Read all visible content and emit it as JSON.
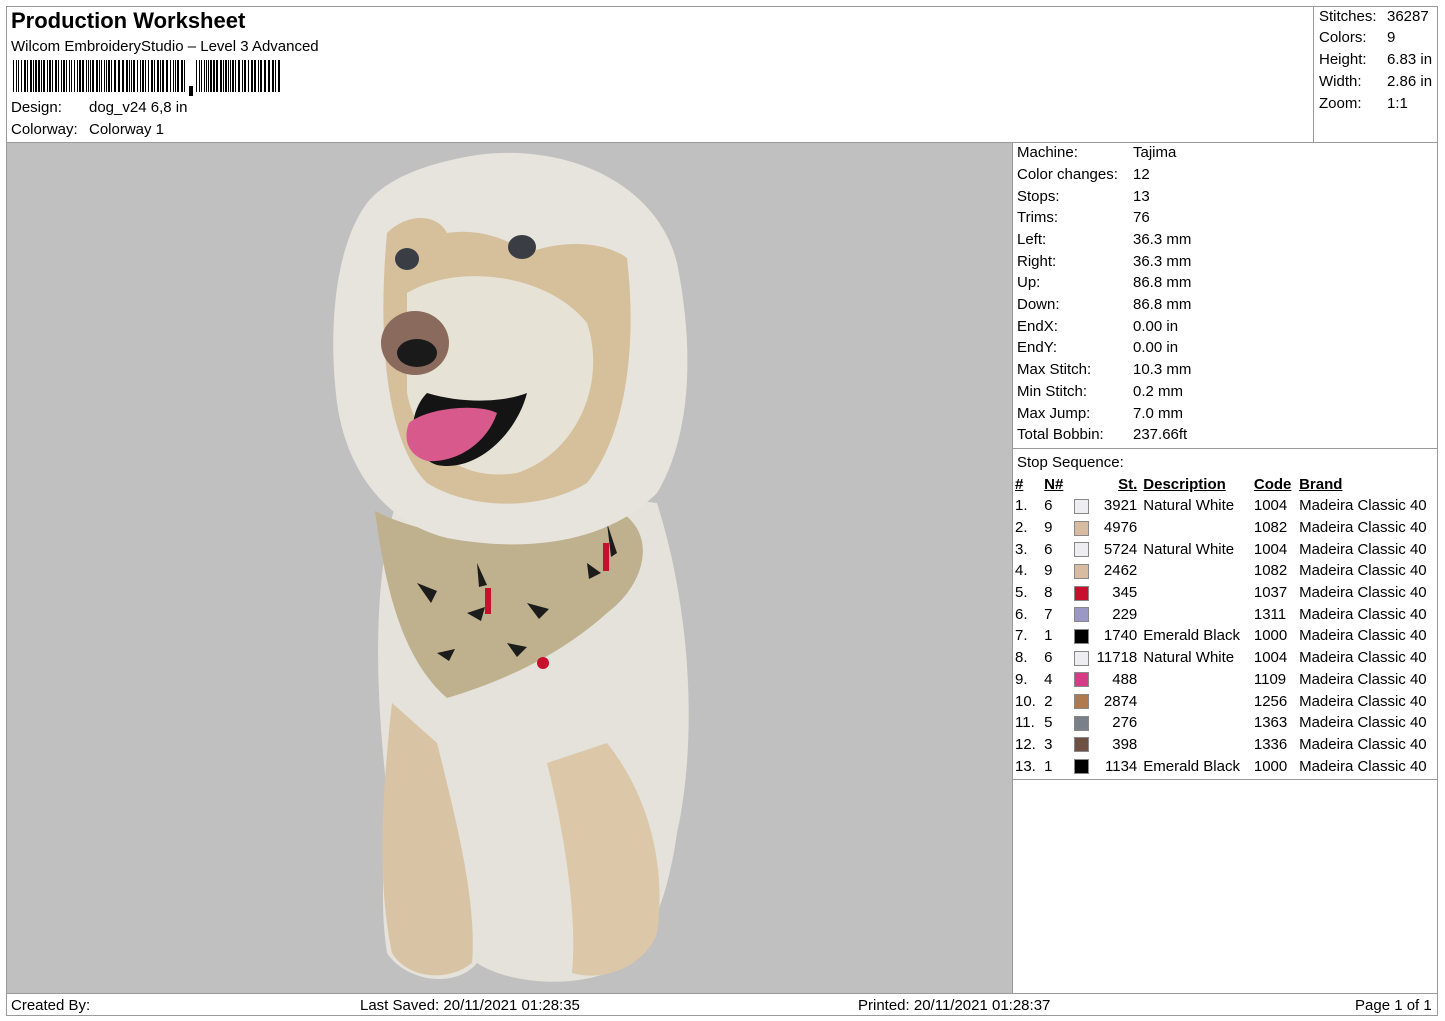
{
  "header": {
    "title": "Production Worksheet",
    "software": "Wilcom EmbroideryStudio – Level 3 Advanced",
    "design_label": "Design:",
    "design_value": "dog_v24 6,8 in",
    "colorway_label": "Colorway:",
    "colorway_value": "Colorway 1"
  },
  "stats": [
    {
      "label": "Stitches:",
      "value": "36287"
    },
    {
      "label": "Colors:",
      "value": "9"
    },
    {
      "label": "Height:",
      "value": "6.83 in"
    },
    {
      "label": "Width:",
      "value": "2.86 in"
    },
    {
      "label": "Zoom:",
      "value": "1:1"
    }
  ],
  "machine_info": [
    {
      "label": "Machine:",
      "value": "Tajima"
    },
    {
      "label": "Color changes:",
      "value": "12"
    },
    {
      "label": "Stops:",
      "value": "13"
    },
    {
      "label": "Trims:",
      "value": "76"
    },
    {
      "label": "Left:",
      "value": "36.3 mm"
    },
    {
      "label": "Right:",
      "value": "36.3 mm"
    },
    {
      "label": "Up:",
      "value": "86.8 mm"
    },
    {
      "label": "Down:",
      "value": "86.8 mm"
    },
    {
      "label": "EndX:",
      "value": "0.00 in"
    },
    {
      "label": "EndY:",
      "value": "0.00 in"
    },
    {
      "label": "Max Stitch:",
      "value": "10.3 mm"
    },
    {
      "label": "Min Stitch:",
      "value": "0.2 mm"
    },
    {
      "label": "Max Jump:",
      "value": "7.0 mm"
    },
    {
      "label": "Total Bobbin:",
      "value": "237.66ft"
    }
  ],
  "stop_sequence": {
    "title": "Stop Sequence:",
    "headers": {
      "idx": "#",
      "n": "N#",
      "st": "St.",
      "desc": "Description",
      "code": "Code",
      "brand": "Brand"
    },
    "rows": [
      {
        "idx": "1.",
        "n": "6",
        "color": "#eeeef2",
        "st": "3921",
        "desc": "Natural White",
        "code": "1004",
        "brand": "Madeira Classic 40"
      },
      {
        "idx": "2.",
        "n": "9",
        "color": "#d8bca2",
        "st": "4976",
        "desc": "",
        "code": "1082",
        "brand": "Madeira Classic 40"
      },
      {
        "idx": "3.",
        "n": "6",
        "color": "#eeeef2",
        "st": "5724",
        "desc": "Natural White",
        "code": "1004",
        "brand": "Madeira Classic 40"
      },
      {
        "idx": "4.",
        "n": "9",
        "color": "#d8bca2",
        "st": "2462",
        "desc": "",
        "code": "1082",
        "brand": "Madeira Classic 40"
      },
      {
        "idx": "5.",
        "n": "8",
        "color": "#c8102e",
        "st": "345",
        "desc": "",
        "code": "1037",
        "brand": "Madeira Classic 40"
      },
      {
        "idx": "6.",
        "n": "7",
        "color": "#9c98c6",
        "st": "229",
        "desc": "",
        "code": "1311",
        "brand": "Madeira Classic 40"
      },
      {
        "idx": "7.",
        "n": "1",
        "color": "#000000",
        "st": "1740",
        "desc": "Emerald Black",
        "code": "1000",
        "brand": "Madeira Classic 40"
      },
      {
        "idx": "8.",
        "n": "6",
        "color": "#eeeef2",
        "st": "11718",
        "desc": "Natural White",
        "code": "1004",
        "brand": "Madeira Classic 40"
      },
      {
        "idx": "9.",
        "n": "4",
        "color": "#d63c86",
        "st": "488",
        "desc": "",
        "code": "1109",
        "brand": "Madeira Classic 40"
      },
      {
        "idx": "10.",
        "n": "2",
        "color": "#b07a4e",
        "st": "2874",
        "desc": "",
        "code": "1256",
        "brand": "Madeira Classic 40"
      },
      {
        "idx": "11.",
        "n": "5",
        "color": "#7a808a",
        "st": "276",
        "desc": "",
        "code": "1363",
        "brand": "Madeira Classic 40"
      },
      {
        "idx": "12.",
        "n": "3",
        "color": "#6e5144",
        "st": "398",
        "desc": "",
        "code": "1336",
        "brand": "Madeira Classic 40"
      },
      {
        "idx": "13.",
        "n": "1",
        "color": "#000000",
        "st": "1134",
        "desc": "Emerald Black",
        "code": "1000",
        "brand": "Madeira Classic 40"
      }
    ]
  },
  "footer": {
    "created_by": "Created By:",
    "last_saved": "Last Saved: 20/11/2021 01:28:35",
    "printed": "Printed: 20/11/2021 01:28:37",
    "page": "Page 1 of 1"
  }
}
